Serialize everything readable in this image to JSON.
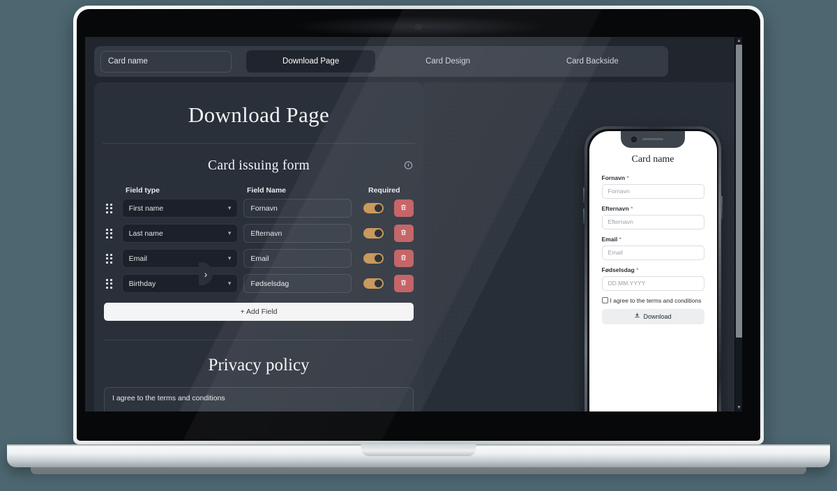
{
  "topbar": {
    "card_name_value": "Card name",
    "tabs": [
      {
        "label": "Download Page",
        "active": true
      },
      {
        "label": "Card Design",
        "active": false
      },
      {
        "label": "Card Backside",
        "active": false
      }
    ]
  },
  "panel": {
    "page_title": "Download Page",
    "section_title": "Card issuing form",
    "info_icon": "info-icon",
    "columns": {
      "field_type": "Field type",
      "field_name": "Field Name",
      "required": "Required"
    },
    "rows": [
      {
        "type": "First name",
        "name": "Fornavn",
        "required": true,
        "delete_icon": "trash-icon"
      },
      {
        "type": "Last name",
        "name": "Efternavn",
        "required": true,
        "delete_icon": "trash-icon"
      },
      {
        "type": "Email",
        "name": "Email",
        "required": true,
        "delete_icon": "trash-icon"
      },
      {
        "type": "Birthday",
        "name": "Fødselsdag",
        "required": true,
        "delete_icon": "trash-icon"
      }
    ],
    "add_field_label": "+ Add Field",
    "privacy_title": "Privacy policy",
    "privacy_text": "I agree to the terms and conditions"
  },
  "collapse_button": {
    "icon": "chevron-right-icon"
  },
  "phone_preview": {
    "title": "Card name",
    "fields": [
      {
        "label": "Fornavn",
        "required_mark": "*",
        "placeholder": "Fornavn"
      },
      {
        "label": "Efternavn",
        "required_mark": "*",
        "placeholder": "Efternavn"
      },
      {
        "label": "Email",
        "required_mark": "*",
        "placeholder": "Email"
      },
      {
        "label": "Fødselsdag",
        "required_mark": "*",
        "placeholder": "DD.MM.YYYY"
      }
    ],
    "consent_label": "I agree to the terms and conditions",
    "download_label": "Download",
    "download_icon": "download-icon"
  },
  "colors": {
    "backdrop": "#4d6670",
    "panel_bg": "#2a303a",
    "viewport_bg": "#21262e",
    "topbar_bg": "#353b45",
    "accent_toggle": "#c4904f",
    "danger": "#c0585c",
    "add_field_bg": "#f3f4f5"
  },
  "scrollbar": {
    "up_arrow": "▲",
    "down_arrow": "▼"
  }
}
